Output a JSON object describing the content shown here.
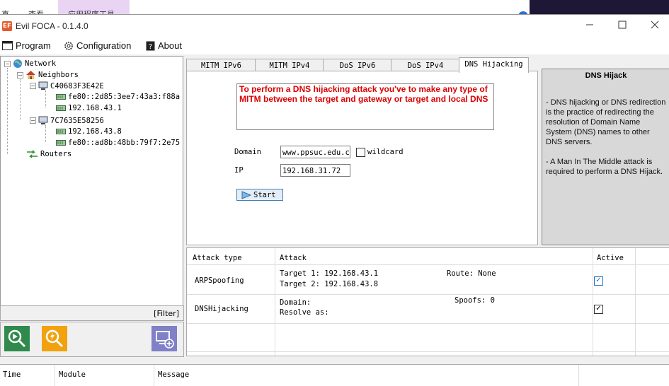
{
  "background_window": {
    "text_left": "直",
    "text_view": "查看",
    "tab_label": "应用程序工具"
  },
  "window": {
    "title": "Evil FOCA - 0.1.4.0",
    "icon_label": "EF"
  },
  "menu": {
    "program": "Program",
    "configuration": "Configuration",
    "about": "About"
  },
  "tree": {
    "root": "Network",
    "neighbors": "Neighbors",
    "host1": {
      "name": "C40683F3E42E",
      "addrs": [
        "fe80::2d85:3ee7:43a3:f88a",
        "192.168.43.1"
      ]
    },
    "host2": {
      "name": "7C7635E58256",
      "addrs": [
        "192.168.43.8",
        "fe80::ad8b:48bb:79f7:2e75"
      ]
    },
    "routers": "Routers"
  },
  "filter_label": "[Filter]",
  "tabs": [
    "MITM IPv6",
    "MITM IPv4",
    "DoS IPv6",
    "DoS IPv4",
    "DNS Hijacking"
  ],
  "active_tab": "DNS Hijacking",
  "dns_form": {
    "warning": "To perform a DNS hijacking attack you've to make any type of MITM between the target and gateway or target and local DNS",
    "domain_label": "Domain",
    "domain_value": "www.ppsuc.edu.cn",
    "wildcard_label": "wildcard",
    "ip_label": "IP",
    "ip_value": "192.168.31.72",
    "start_label": "Start"
  },
  "info": {
    "title": "DNS Hijack",
    "p1": "- DNS hijacking or DNS redirection is the practice of redirecting the resolution of Domain Name System (DNS) names to other DNS servers.",
    "p2": "- A Man In The Middle attack is required to perform a DNS Hijack."
  },
  "attacks": {
    "headers": {
      "type": "Attack type",
      "attack": "Attack",
      "active": "Active"
    },
    "rows": [
      {
        "type": "ARPSpoofing",
        "line1": "Target 1: 192.168.43.1",
        "line2": "Target 2: 192.168.43.8",
        "extra": "Route: None",
        "active": true
      },
      {
        "type": "DNSHijacking",
        "line1": "Domain:",
        "line2": "Resolve as:",
        "extra": "Spoofs: 0",
        "active": true
      }
    ]
  },
  "log": {
    "headers": [
      "Time",
      "Module",
      "Message"
    ]
  },
  "colors": {
    "warning_text": "#dd0000",
    "active_check": "#1c6fc0"
  }
}
